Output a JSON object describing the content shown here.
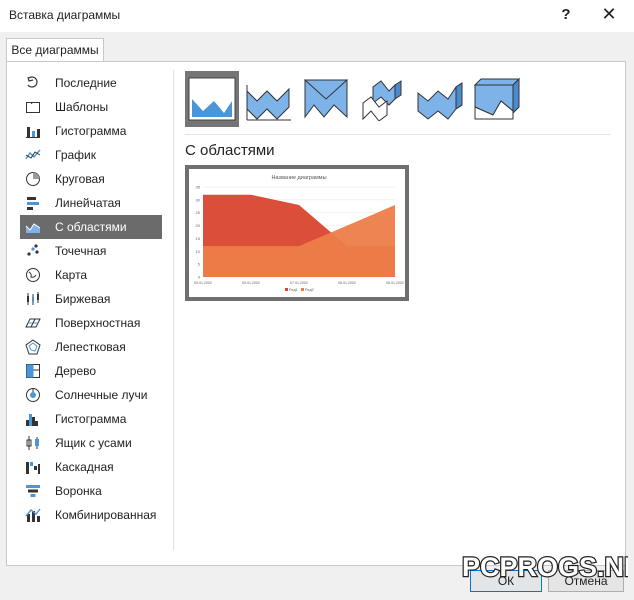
{
  "window": {
    "title": "Вставка диаграммы",
    "help": "?",
    "close": "✕"
  },
  "tab": {
    "label": "Все диаграммы"
  },
  "sidebar": {
    "items": [
      {
        "label": "Последние",
        "icon": "recent-icon"
      },
      {
        "label": "Шаблоны",
        "icon": "folder-icon"
      },
      {
        "label": "Гистограмма",
        "icon": "column-chart-icon"
      },
      {
        "label": "График",
        "icon": "line-chart-icon"
      },
      {
        "label": "Круговая",
        "icon": "pie-chart-icon"
      },
      {
        "label": "Линейчатая",
        "icon": "bar-chart-icon"
      },
      {
        "label": "С областями",
        "icon": "area-chart-icon",
        "selected": true
      },
      {
        "label": "Точечная",
        "icon": "scatter-chart-icon"
      },
      {
        "label": "Карта",
        "icon": "map-chart-icon"
      },
      {
        "label": "Биржевая",
        "icon": "stock-chart-icon"
      },
      {
        "label": "Поверхностная",
        "icon": "surface-chart-icon"
      },
      {
        "label": "Лепестковая",
        "icon": "radar-chart-icon"
      },
      {
        "label": "Дерево",
        "icon": "treemap-chart-icon"
      },
      {
        "label": "Солнечные лучи",
        "icon": "sunburst-chart-icon"
      },
      {
        "label": "Гистограмма",
        "icon": "histogram-chart-icon"
      },
      {
        "label": "Ящик с усами",
        "icon": "box-whisker-chart-icon"
      },
      {
        "label": "Каскадная",
        "icon": "waterfall-chart-icon"
      },
      {
        "label": "Воронка",
        "icon": "funnel-chart-icon"
      },
      {
        "label": "Комбинированная",
        "icon": "combo-chart-icon"
      }
    ]
  },
  "main": {
    "section_title": "С областями",
    "subtypes": [
      "area",
      "stacked-area",
      "100-stacked-area",
      "3d-area",
      "3d-stacked-area",
      "3d-100-stacked-area"
    ]
  },
  "preview_chart": {
    "chart_data": {
      "type": "area",
      "title": "Название диаграммы",
      "categories": [
        "00.01.2002",
        "00.01.2002",
        "07.01.2002",
        "08.01.2002",
        "08.01.2002"
      ],
      "series": [
        {
          "name": "Ряд1",
          "values": [
            32,
            32,
            28,
            12,
            12
          ],
          "color": "#d9452e"
        },
        {
          "name": "Ряд2",
          "values": [
            12,
            12,
            12,
            20,
            28
          ],
          "color": "#ed7d48"
        }
      ],
      "yticks": [
        "0",
        "5",
        "10",
        "15",
        "20",
        "25",
        "30",
        "35"
      ],
      "ylim": [
        0,
        35
      ],
      "legend_position": "bottom"
    }
  },
  "buttons": {
    "ok": "ОК",
    "cancel": "Отмена"
  },
  "watermark": {
    "text": "PCPROGS.NET"
  }
}
